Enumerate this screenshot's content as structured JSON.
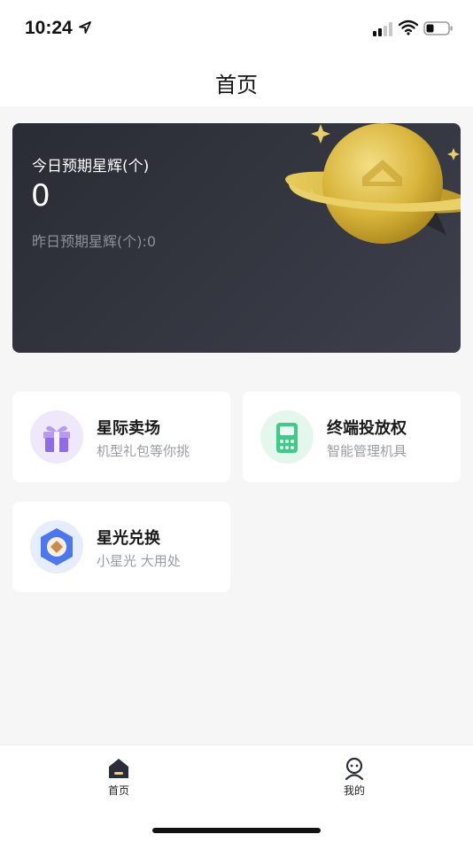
{
  "status_bar": {
    "time": "10:24"
  },
  "nav": {
    "title": "首页"
  },
  "hero": {
    "today_label": "今日预期星辉(个)",
    "today_value": "0",
    "yesterday_text": "昨日预期星辉(个):0"
  },
  "entries": [
    {
      "title": "星际卖场",
      "subtitle": "机型礼包等你挑",
      "icon": "gift-icon"
    },
    {
      "title": "终端投放权",
      "subtitle": "智能管理机具",
      "icon": "pos-terminal-icon"
    },
    {
      "title": "星光兑换",
      "subtitle": "小星光  大用处",
      "icon": "exchange-badge-icon"
    }
  ],
  "tabs": [
    {
      "label": "首页",
      "icon": "home-icon",
      "active": true
    },
    {
      "label": "我的",
      "icon": "profile-icon",
      "active": false
    }
  ],
  "colors": {
    "hero_bg": "#2f313b",
    "planet_gold": "#e3c24a",
    "gift_purple": "#8f6be8",
    "terminal_green": "#3fc98a",
    "exchange_blue": "#4b78f0"
  }
}
